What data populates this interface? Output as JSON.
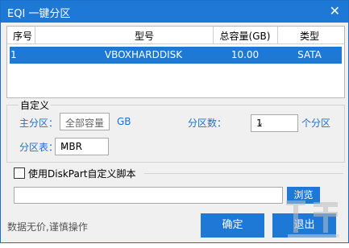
{
  "window": {
    "title": "EQI 一键分区",
    "close_glyph": "✕"
  },
  "table": {
    "headers": [
      "序号",
      "型号",
      "总容量(GB)",
      "类型"
    ],
    "rows": [
      [
        "1",
        "VBOXHARDDISK",
        "10.00",
        "SATA"
      ]
    ]
  },
  "custom": {
    "group_label": "自定义",
    "primary_label": "主分区：",
    "primary_value": "全部容量",
    "unit_gb": "GB",
    "count_label": "分区数：",
    "count_value": "1",
    "count_suffix": "个分区",
    "table_label": "分区表：",
    "table_value": "MBR"
  },
  "diskpart": {
    "checkbox_label": "使用DiskPart自定义脚本",
    "checked": false,
    "path_value": "",
    "browse_label": "浏览"
  },
  "footer": {
    "warning": "数据无价,谨慎操作",
    "ok_label": "确定",
    "exit_label": "退出"
  },
  "colors": {
    "accent": "#1e78d6",
    "label_blue": "#1e6fd0"
  }
}
